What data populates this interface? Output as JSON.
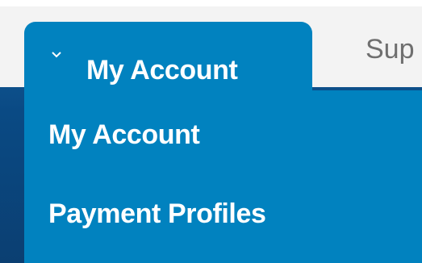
{
  "nav": {
    "active_tab": {
      "label": "My Account",
      "icon": "chevron-down-icon"
    },
    "inactive_tab": {
      "label": "Sup"
    }
  },
  "dropdown": {
    "items": [
      {
        "label": "My Account"
      },
      {
        "label": "Payment Profiles"
      }
    ]
  },
  "colors": {
    "active_tab_bg": "#0182bf",
    "nav_band_bg": "#0b3f72",
    "text_light": "#ffffff",
    "inactive_tab_text": "#6f6f6f"
  }
}
